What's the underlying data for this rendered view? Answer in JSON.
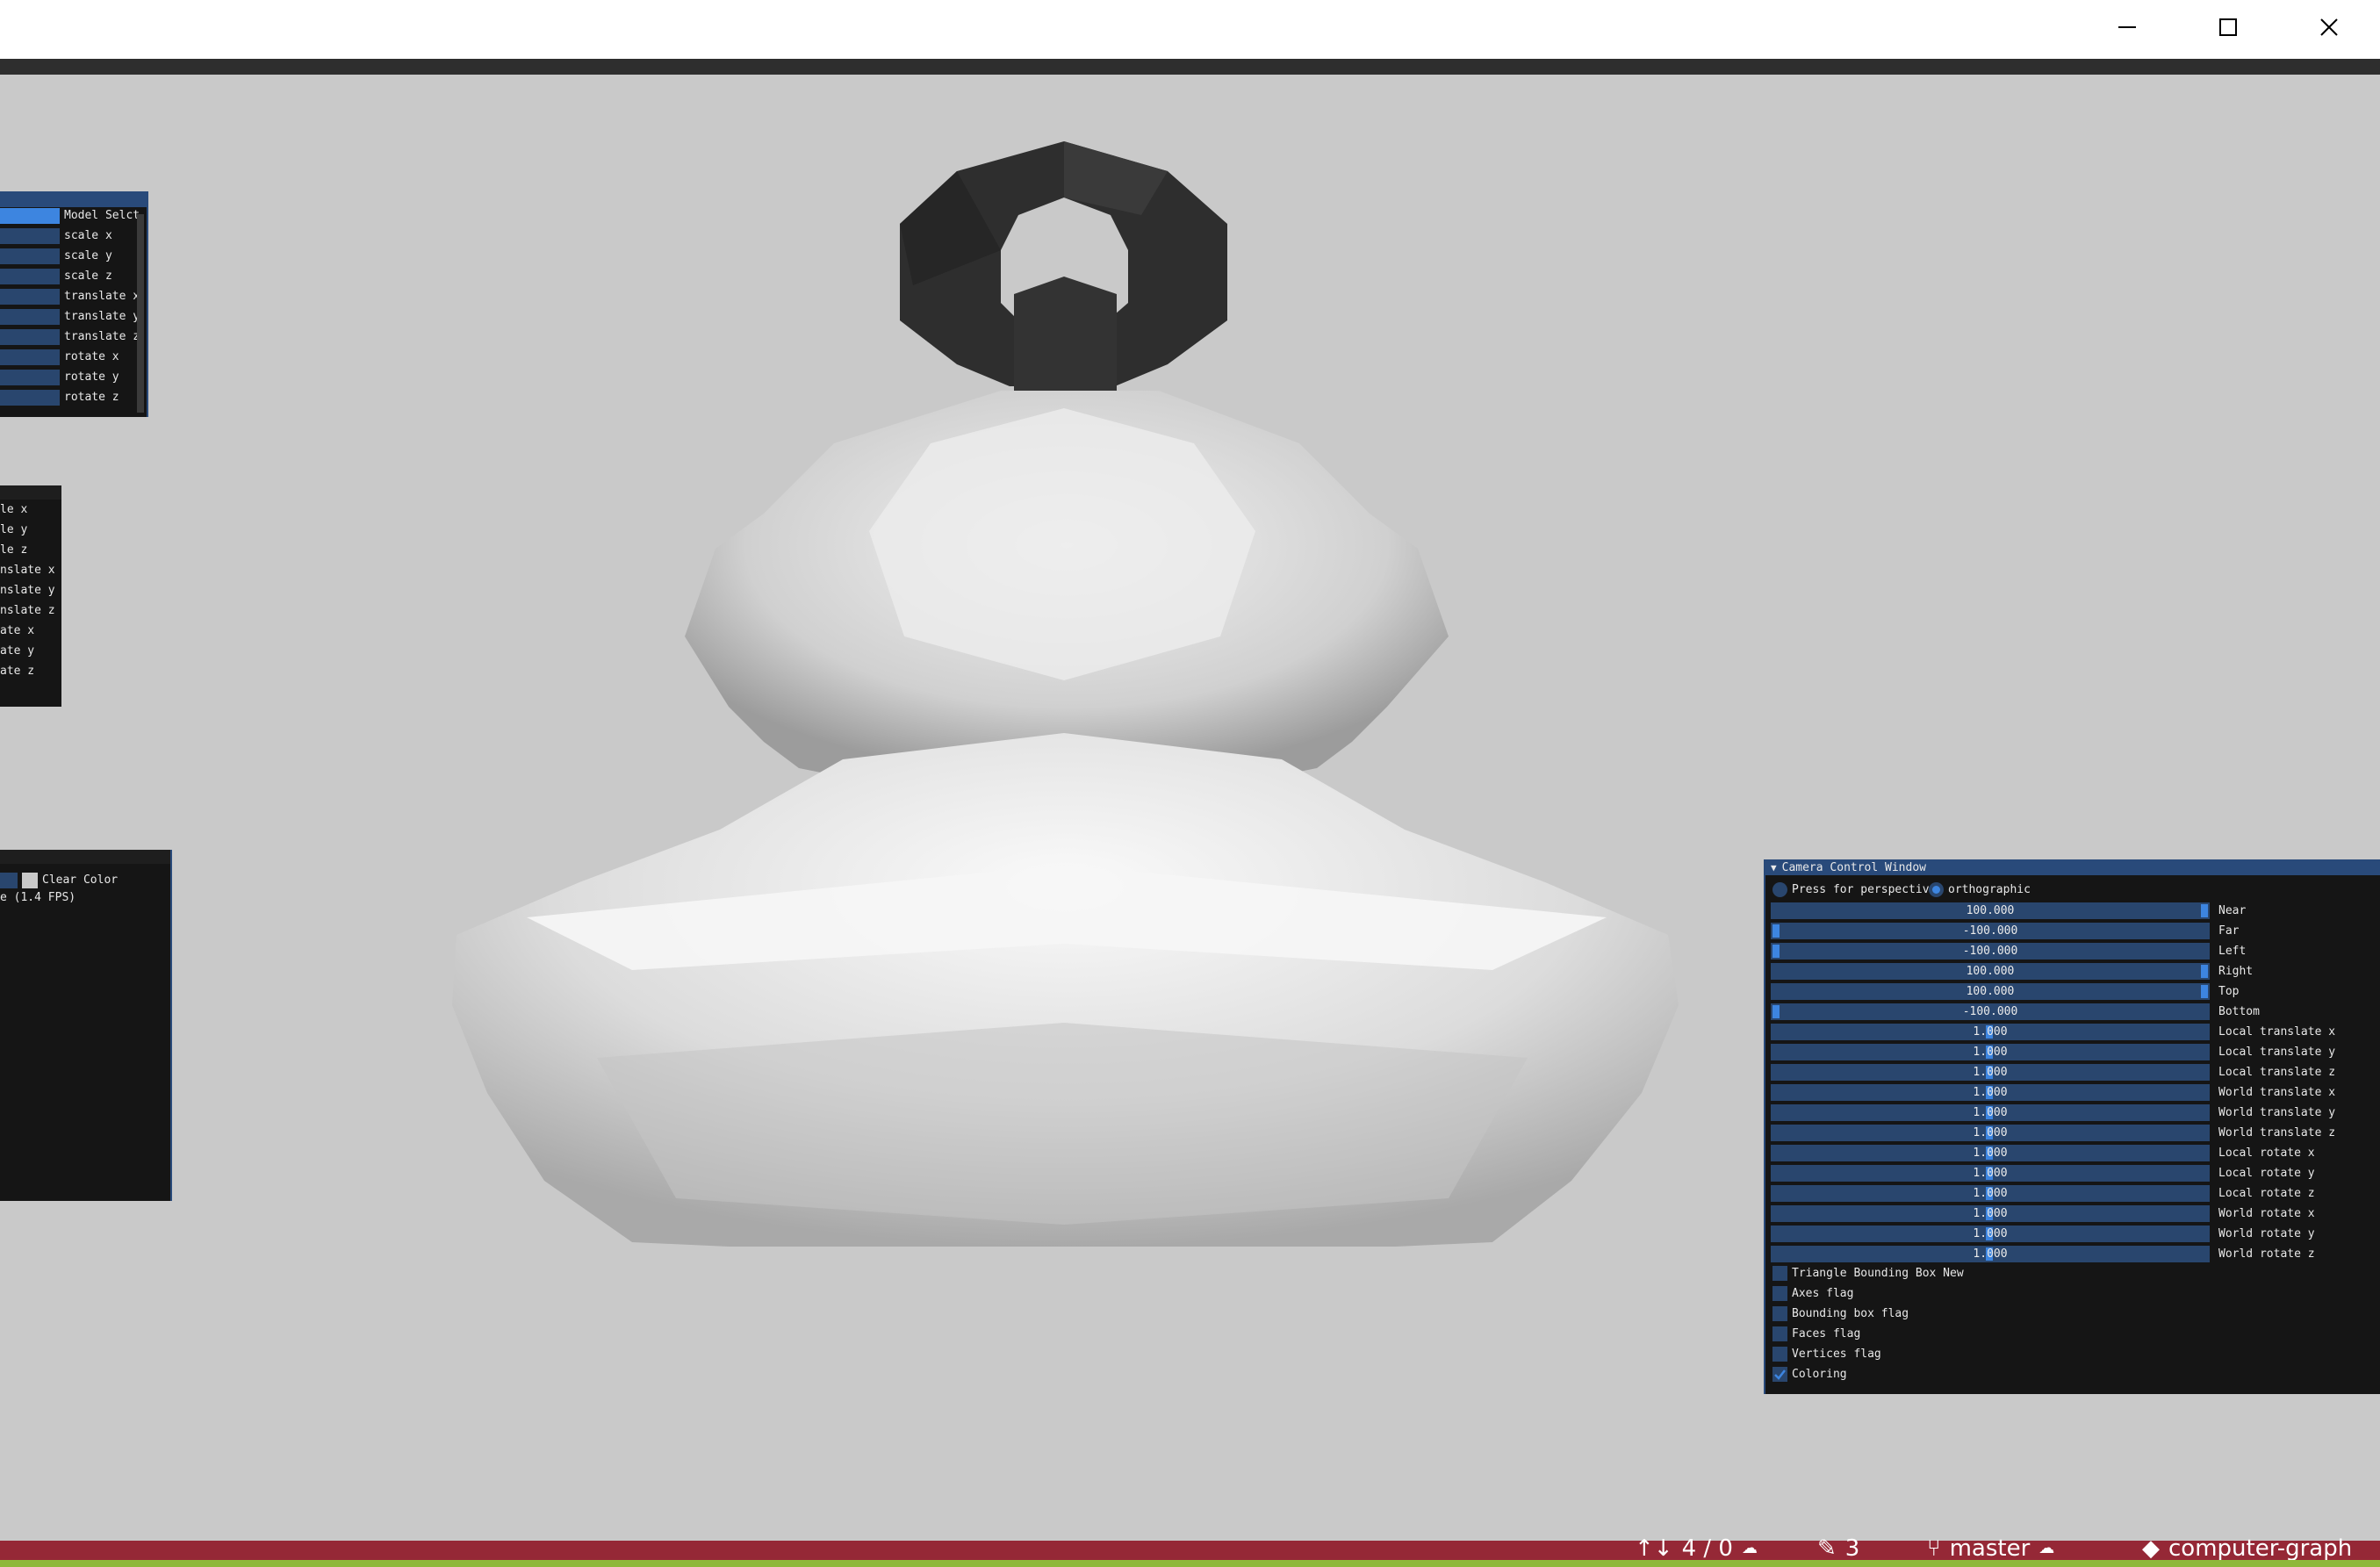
{
  "window": {
    "controls": [
      "minimize-icon",
      "maximize-icon",
      "close-icon"
    ]
  },
  "model_panel": {
    "labels": [
      "Model Selct",
      "scale x",
      "scale y",
      "scale z",
      "translate x",
      "translate y",
      "translate z",
      "rotate x",
      "rotate y",
      "rotate z"
    ]
  },
  "second_panel": {
    "labels": [
      "le x",
      "le y",
      "le z",
      "nslate x",
      "nslate y",
      "nslate z",
      "ate x",
      "ate y",
      "ate z"
    ]
  },
  "color_panel": {
    "clear_color_label": "Clear Color",
    "fps_text": "e (1.4 FPS)"
  },
  "camera_panel": {
    "title": "Camera Control Window",
    "radio_perspective": "Press for perspective",
    "radio_orthographic": "orthographic",
    "selected_projection": "orthographic",
    "sliders": [
      {
        "value": "100.000",
        "label": "Near"
      },
      {
        "value": "-100.000",
        "label": "Far"
      },
      {
        "value": "-100.000",
        "label": "Left"
      },
      {
        "value": "100.000",
        "label": "Right"
      },
      {
        "value": "100.000",
        "label": "Top"
      },
      {
        "value": "-100.000",
        "label": "Bottom"
      },
      {
        "value": "1.000",
        "label": "Local translate x"
      },
      {
        "value": "1.000",
        "label": "Local translate y"
      },
      {
        "value": "1.000",
        "label": "Local translate z"
      },
      {
        "value": "1.000",
        "label": "World translate x"
      },
      {
        "value": "1.000",
        "label": "World translate y"
      },
      {
        "value": "1.000",
        "label": "World translate z"
      },
      {
        "value": "1.000",
        "label": "Local rotate x"
      },
      {
        "value": "1.000",
        "label": "Local rotate y"
      },
      {
        "value": "1.000",
        "label": "Local rotate z"
      },
      {
        "value": "1.000",
        "label": "World rotate x"
      },
      {
        "value": "1.000",
        "label": "World rotate y"
      },
      {
        "value": "1.000",
        "label": "World rotate z"
      }
    ],
    "checkboxes": [
      {
        "label": "Triangle Bounding Box New",
        "checked": false
      },
      {
        "label": "Axes flag",
        "checked": false
      },
      {
        "label": "Bounding box flag",
        "checked": false
      },
      {
        "label": "Faces flag",
        "checked": false
      },
      {
        "label": "Vertices flag",
        "checked": false
      },
      {
        "label": "Coloring",
        "checked": true
      }
    ]
  },
  "status_bar": {
    "sync": "4 / 0",
    "edits": "3",
    "branch": "master",
    "repo": "computer-graph"
  },
  "colors": {
    "status_bar": "#952836",
    "status_bar_bottom": "#8fb83a",
    "panel_bg": "#151515",
    "slider_bg": "#29466e",
    "accent": "#3d85e0",
    "viewport_bg": "#c9c9c9"
  }
}
